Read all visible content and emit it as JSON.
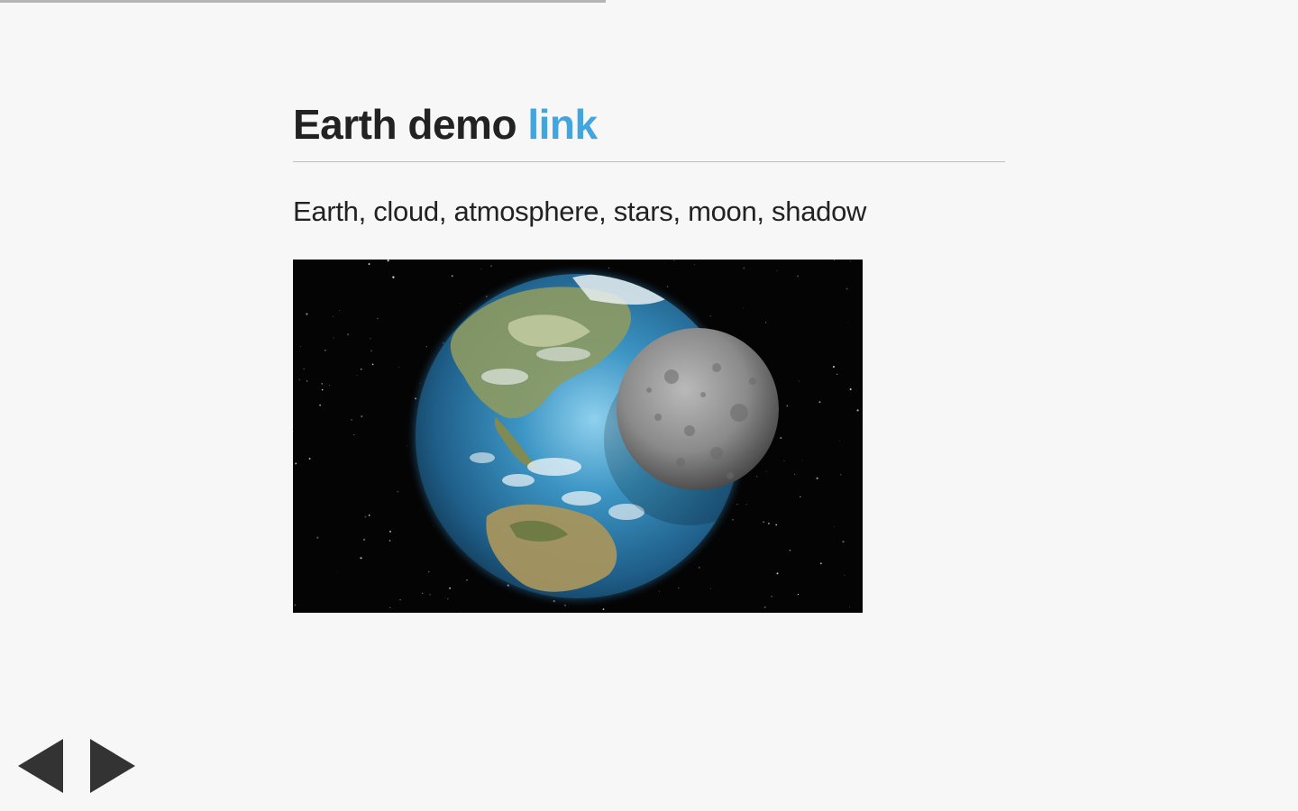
{
  "progress": {
    "fraction": 0.467
  },
  "slide": {
    "title_main": "Earth demo",
    "title_link": "link",
    "description": "Earth, cloud, atmosphere, stars, moon, shadow",
    "image_label": "earth-moon-render"
  },
  "colors": {
    "link": "#42a5e0",
    "text": "#222222",
    "background": "#f7f7f7",
    "nav_arrow": "#333333"
  },
  "navigation": {
    "prev_icon": "triangle-left-icon",
    "next_icon": "triangle-right-icon"
  }
}
